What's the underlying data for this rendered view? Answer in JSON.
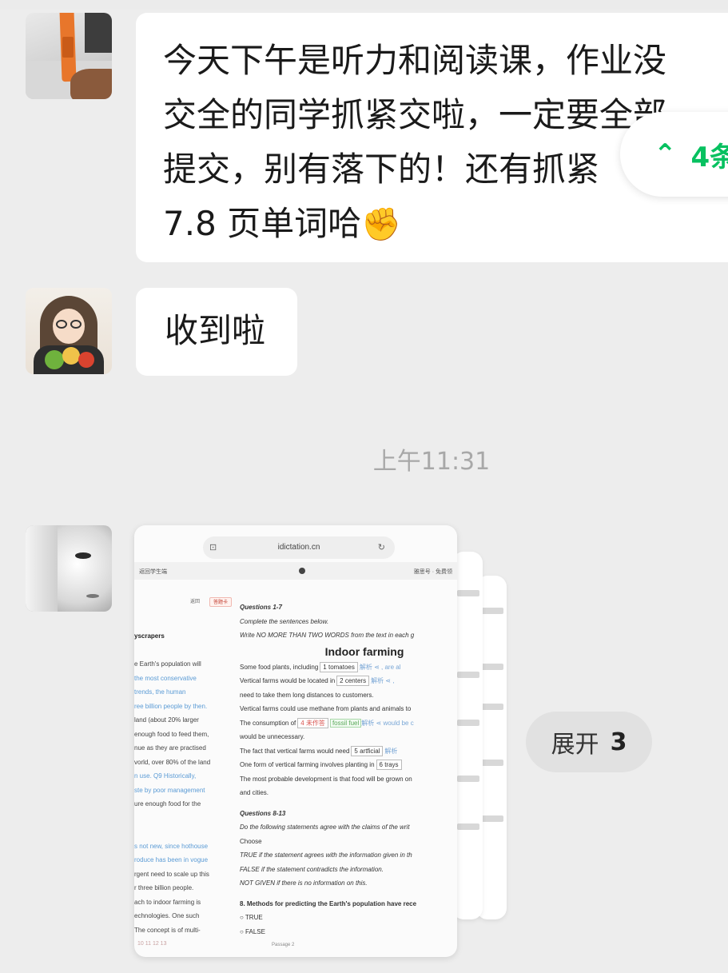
{
  "messages": [
    {
      "lines": [
        "今天下午是听力和阅读课，作业没",
        "交全的同学抓紧交啦，一定要全部",
        "提交，别有落下的！还有抓紧",
        "7.8 页单词哈"
      ],
      "emoji": "✊"
    },
    {
      "text": "收到啦"
    }
  ],
  "unread": {
    "icon": "double-chevron-up-icon",
    "count_label": "4条"
  },
  "timestamp": "上午11:31",
  "image_card": {
    "url": "idictation.cn",
    "toolbar_left": "返回学生端",
    "toolbar_right": "雅思号 · 免费领",
    "btn_a": "返回",
    "btn_b": "答题卡",
    "left_lines": [
      {
        "text": "yscrapers",
        "style": "bold"
      },
      {
        "text": "",
        "style": ""
      },
      {
        "text": "e Earth's population will",
        "style": ""
      },
      {
        "text": "the most conservative",
        "style": "blue"
      },
      {
        "text": "trends, the human",
        "style": "blue"
      },
      {
        "text": "ree billion people by then.",
        "style": "blue"
      },
      {
        "text": "land (about 20% larger",
        "style": ""
      },
      {
        "text": "enough food to feed them,",
        "style": ""
      },
      {
        "text": "nue as they are practised",
        "style": ""
      },
      {
        "text": "vorld, over 80% of the land",
        "style": ""
      },
      {
        "text": "n use. Q9 Historically,",
        "style": "blue"
      },
      {
        "text": "ste by poor management",
        "style": "blue"
      },
      {
        "text": "ure enough food for the",
        "style": ""
      },
      {
        "text": "",
        "style": ""
      },
      {
        "text": "",
        "style": ""
      },
      {
        "text": "s not new, since hothouse",
        "style": "blue"
      },
      {
        "text": "roduce has been in vogue",
        "style": "blue"
      },
      {
        "text": "rgent need to scale up this",
        "style": ""
      },
      {
        "text": "r three billion people.",
        "style": ""
      },
      {
        "text": "ach to indoor farming is",
        "style": ""
      },
      {
        "text": "echnologies. One such",
        "style": ""
      },
      {
        "text": "The concept is of multi-",
        "style": ""
      }
    ],
    "questions_title": "Questions 1-7",
    "instr1": "Complete the sentences below.",
    "instr2": "Write NO MORE THAN TWO WORDS from the text in each g",
    "heading": "Indoor farming",
    "s1_pre": "Some food plants, including",
    "s1_field": "1 tomatoes",
    "s1_post": "解析 ⋖ , are al",
    "s2_pre": "Vertical farms would be located in",
    "s2_field": "2 centers",
    "s2_post": "解析 ⋖ ,",
    "s2_cont": "need to take them long distances to customers.",
    "s3": "Vertical farms could use methane from plants and animals to",
    "s4_pre": "The consumption of",
    "s4_red": "4 未作答",
    "s4_green": "fossil fuel",
    "s4_post": "解析 ⋖ would be c",
    "s4_cont": "would be unnecessary.",
    "s5_pre": "The fact that vertical farms would need",
    "s5_field": "5 artficial",
    "s5_post": "解析",
    "s6_pre": "One form of vertical farming involves planting in",
    "s6_field": "6 trays",
    "s7": "The most probable development is that food will be grown on",
    "s7_cont": "and cities.",
    "q2_title": "Questions 8-13",
    "q2_instr1": "Do the following statements agree with the claims of the writ",
    "q2_instr2": "Choose",
    "q2_true": "TRUE if the statement agrees with the information given in th",
    "q2_false": "FALSE if the statement contradicts the information.",
    "q2_ng": "NOT GIVEN if there is no information on this.",
    "q8": "8. Methods for predicting the Earth's population have rece",
    "opt_true": "○ TRUE",
    "opt_false": "○ FALSE",
    "footer": "Passage 2",
    "left_bottom": "10  11  12  13"
  },
  "expand": {
    "label": "展开",
    "count": "3"
  }
}
